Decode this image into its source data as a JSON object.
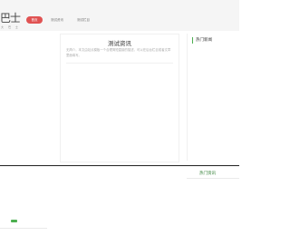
{
  "header": {
    "logo": "巴士",
    "logo_subtitle": "大 巴 士",
    "nav": [
      {
        "label": "首页",
        "active": true
      },
      {
        "label": "测试资讯",
        "active": false
      },
      {
        "label": "测试栏目",
        "active": false
      }
    ]
  },
  "main": {
    "title": "测试资讯",
    "description": "无简介，本文由站点模板一个合理简短直接的描述，可以在后台栏目或者文章里面填写。"
  },
  "sidebar": {
    "heading": "热门新闻"
  },
  "footer": {
    "heading": "热门资讯"
  },
  "colors": {
    "accent": "#e05252",
    "green": "#4caf50"
  }
}
